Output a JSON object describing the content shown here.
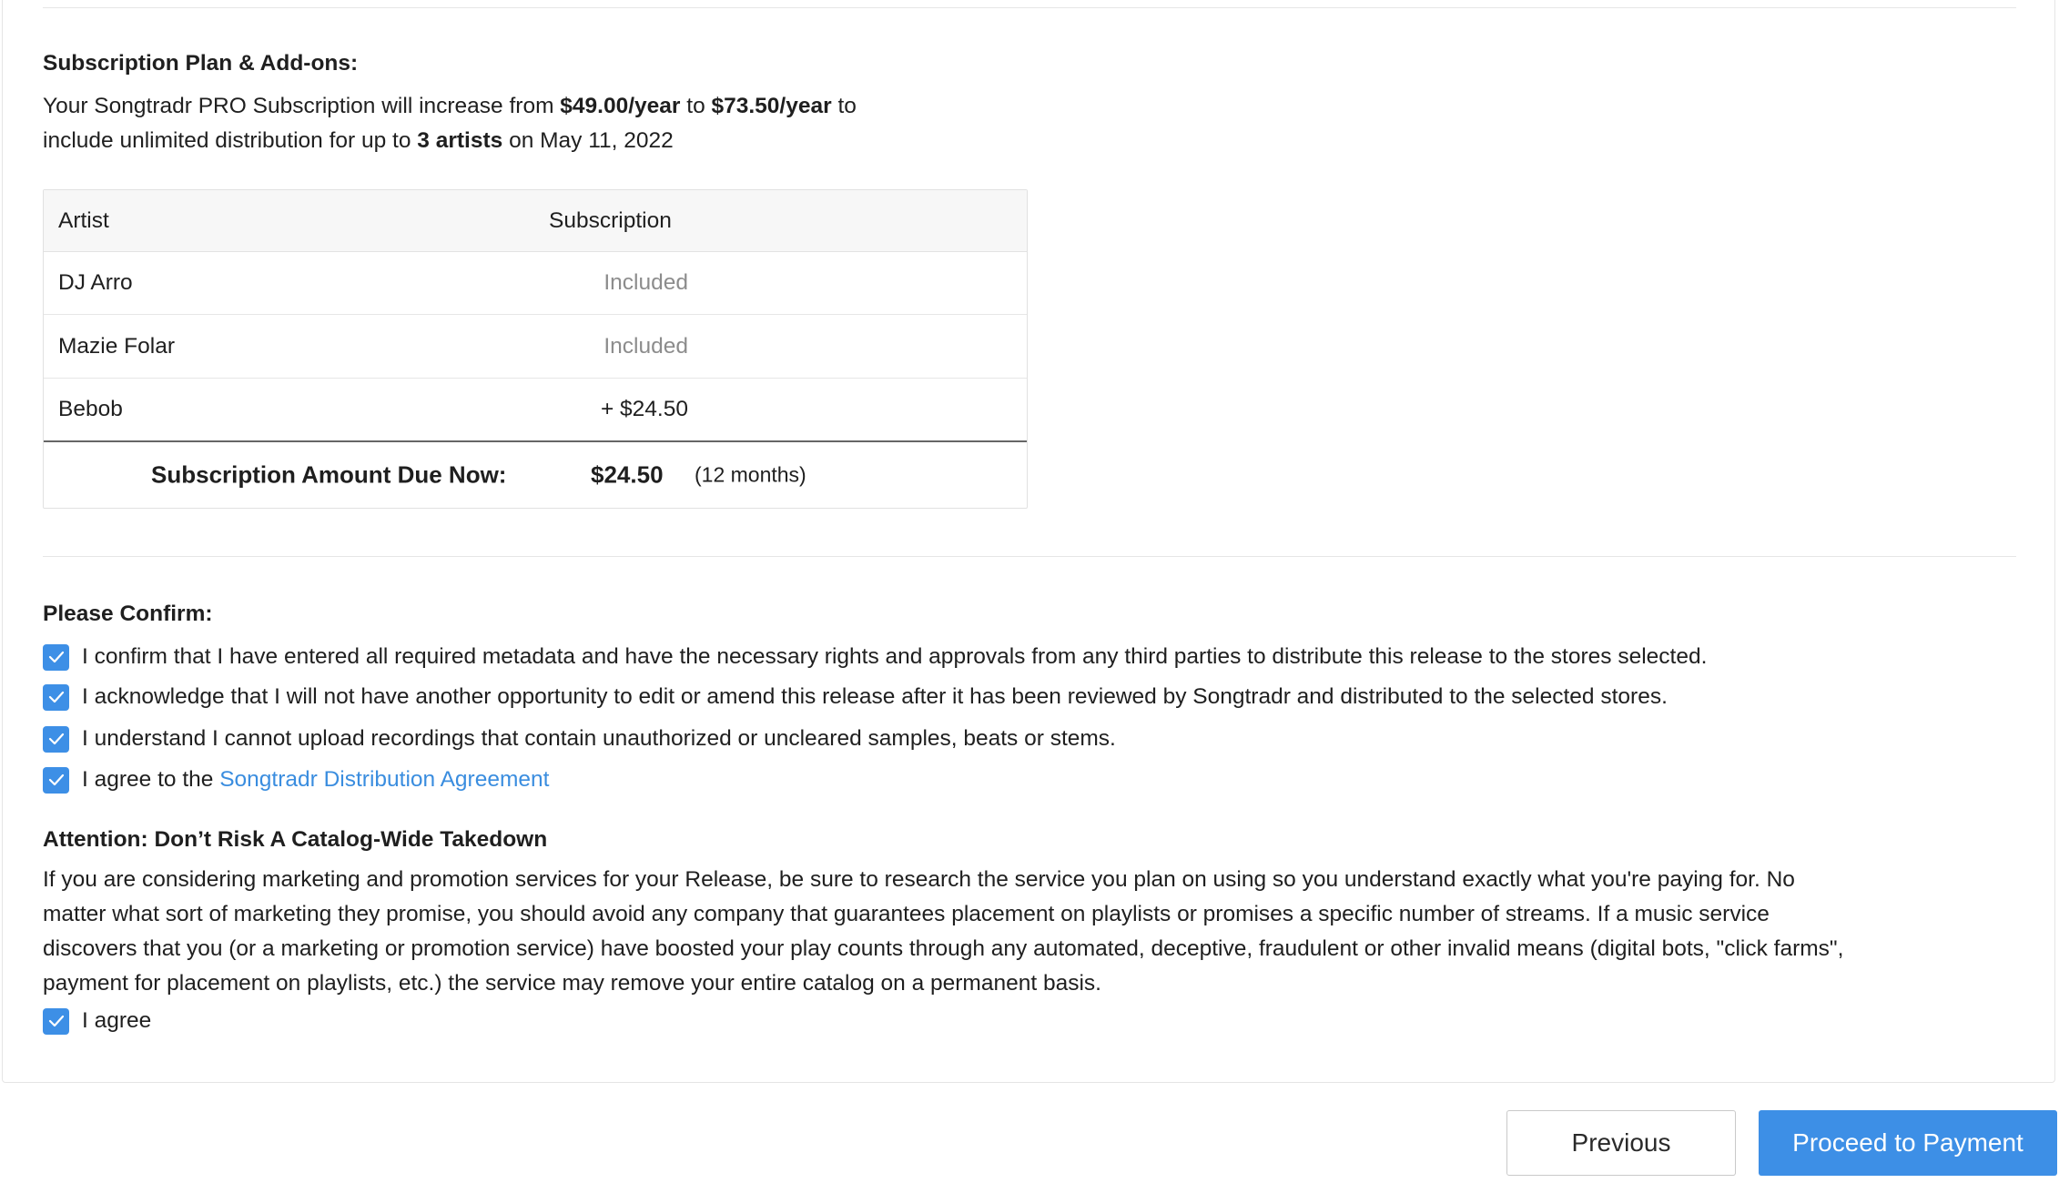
{
  "subscription": {
    "heading": "Subscription Plan & Add-ons:",
    "summary": {
      "part1": "Your Songtradr PRO Subscription will increase from ",
      "from_price": "$49.00/year",
      "part2": " to ",
      "to_price": "$73.50/year",
      "part3": " to",
      "part4": "include unlimited distribution for up to ",
      "artist_count": "3 artists",
      "part5": " on May 11, 2022"
    },
    "table": {
      "col_artist": "Artist",
      "col_subscription": "Subscription",
      "rows": [
        {
          "artist": "DJ Arro",
          "subscription": "Included"
        },
        {
          "artist": "Mazie Folar",
          "subscription": "Included"
        },
        {
          "artist": "Bebob",
          "subscription": "+ $24.50"
        }
      ],
      "total_label": "Subscription Amount Due Now:",
      "total_amount": "$24.50",
      "total_period": "(12 months)"
    }
  },
  "confirm": {
    "heading": "Please Confirm:",
    "items": [
      {
        "label": "I confirm that I have entered all required metadata and have the necessary rights and approvals from any third parties to distribute this release to the stores selected.",
        "checked": true
      },
      {
        "label": "I acknowledge that I will not have another opportunity to edit or amend this release after it has been reviewed by Songtradr and distributed to the selected stores.",
        "checked": true
      },
      {
        "label": "I understand I cannot upload recordings that contain unauthorized or uncleared samples, beats or stems.",
        "checked": true
      },
      {
        "label": "I agree to the ",
        "link": "Songtradr Distribution Agreement",
        "checked": true
      }
    ]
  },
  "attention": {
    "heading": "Attention: Don’t Risk A Catalog-Wide Takedown",
    "lines": [
      "If you are considering marketing and promotion services for your Release, be sure to research the service you plan on using so you understand exactly what you're paying for. No",
      "matter what sort of marketing they promise, you should avoid any company that guarantees placement on playlists or promises a specific number of streams. If a music service",
      "discovers that you (or a marketing or promotion service) have boosted your play counts through any automated, deceptive, fraudulent or other invalid means (digital bots, \"click farms\",",
      "payment for placement on playlists, etc.) the service may remove your entire catalog on a permanent basis."
    ],
    "agree_label": "I agree",
    "agree_checked": true
  },
  "buttons": {
    "previous": "Previous",
    "proceed": "Proceed to Payment"
  },
  "colors": {
    "accent": "#3d8fe6",
    "link": "#3a8ddf",
    "muted_text": "#8c8c8c"
  },
  "icons": {
    "checkbox": "checkmark-icon"
  }
}
